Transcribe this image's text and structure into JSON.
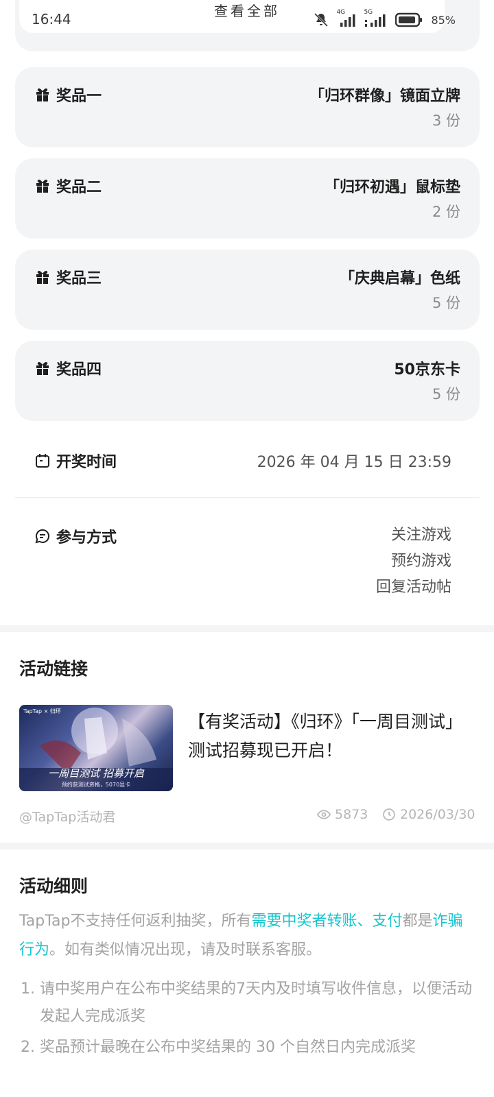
{
  "status_bar": {
    "time": "16:44",
    "battery": "85%",
    "net1": "4G",
    "net2": "5G"
  },
  "top": {
    "view_all": "查看全部"
  },
  "prizes": [
    {
      "label": "奖品一",
      "name": "「归环群像」镜面立牌",
      "count": "3 份"
    },
    {
      "label": "奖品二",
      "name": "「归环初遇」鼠标垫",
      "count": "2 份"
    },
    {
      "label": "奖品三",
      "name": "「庆典启幕」色纸",
      "count": "5 份"
    },
    {
      "label": "奖品四",
      "name": "50京东卡",
      "count": "5 份"
    }
  ],
  "draw_time": {
    "label": "开奖时间",
    "value": "2026 年 04 月 15 日 23:59"
  },
  "participation": {
    "label": "参与方式",
    "methods": [
      "关注游戏",
      "预约游戏",
      "回复活动帖"
    ]
  },
  "activity_link": {
    "section_title": "活动链接",
    "title": "【有奖活动】《归环》「一周目测试」测试招募现已开启！",
    "author": "@TapTap活动君",
    "views": "5873",
    "date": "2026/03/30",
    "thumb_banner": "一周目测试 招募开启",
    "thumb_sub": "预约获测试资格，5070显卡",
    "thumb_logo": "TapTap × 归环"
  },
  "rules": {
    "section_title": "活动细则",
    "p1": "TapTap不支持任何返利抽奖，所有",
    "hl1": "需要中奖者转账、支付",
    "p2": "都是",
    "hl2": "诈骗行为",
    "p3": "。如有类似情况出现，请及时联系客服。",
    "items": [
      {
        "num": "1.",
        "text": "请中奖用户在公布中奖结果的7天内及时填写收件信息，以便活动发起人完成派奖"
      },
      {
        "num": "2.",
        "text": "奖品预计最晚在公布中奖结果的 30 个自然日内完成派奖"
      }
    ]
  },
  "colors": {
    "accent": "#15c5ce",
    "card_bg": "#f3f4f6",
    "muted": "#a3a3a3"
  }
}
